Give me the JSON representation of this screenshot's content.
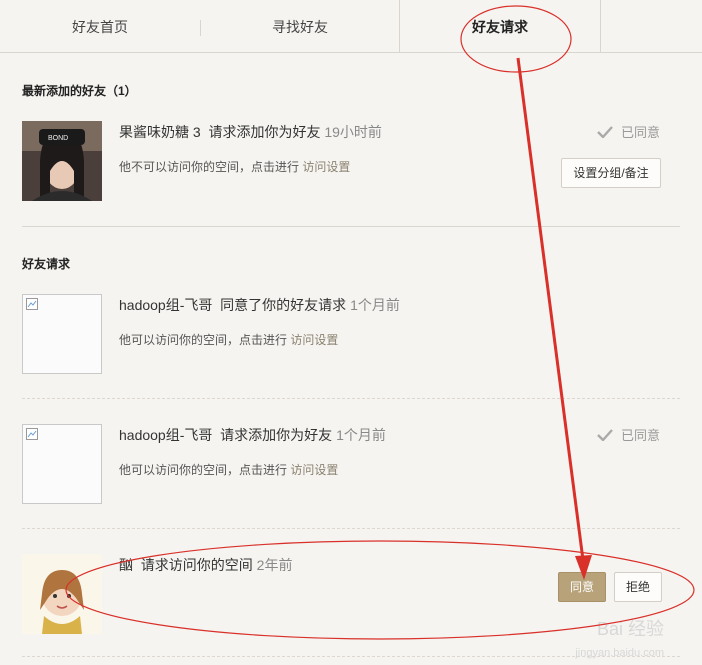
{
  "tabs": [
    {
      "label": "好友首页",
      "active": false
    },
    {
      "label": "寻找好友",
      "active": false
    },
    {
      "label": "好友请求",
      "active": true
    }
  ],
  "recent": {
    "title": "最新添加的好友（1）",
    "item": {
      "name": "果酱味奶糖 3",
      "action": "请求添加你为好友",
      "time": "19小时前",
      "sub_text": "他不可以访问你的空间，点击进行",
      "sub_link": "访问设置",
      "status": "已同意",
      "button": "设置分组/备注"
    }
  },
  "requests": {
    "title": "好友请求",
    "items": [
      {
        "name": "hadoop组-飞哥",
        "action": "同意了你的好友请求",
        "time": "1个月前",
        "sub_text": "他可以访问你的空间，点击进行",
        "sub_link": "访问设置"
      },
      {
        "name": "hadoop组-飞哥",
        "action": "请求添加你为好友",
        "time": "1个月前",
        "sub_text": "他可以访问你的空间，点击进行",
        "sub_link": "访问设置",
        "status": "已同意"
      },
      {
        "name": "酗",
        "action": "请求访问你的空间",
        "time": "2年前",
        "accept": "同意",
        "reject": "拒绝"
      }
    ]
  },
  "watermark": {
    "text": "Bai 经验",
    "url": "jingyan.baidu.com"
  },
  "colors": {
    "accent": "#b7a27a",
    "annotation": "#d9302a",
    "background": "#f6f4f0"
  }
}
